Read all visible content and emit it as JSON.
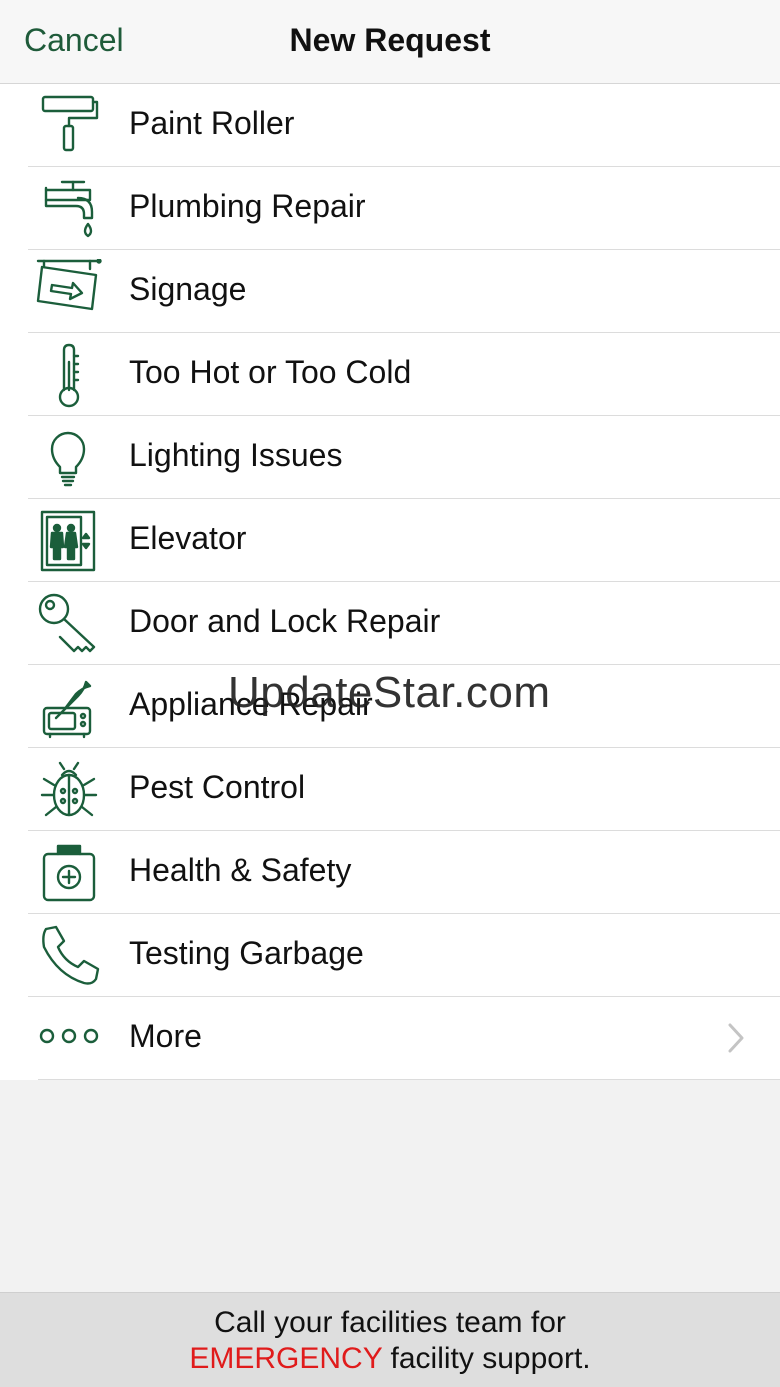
{
  "navbar": {
    "cancel_label": "Cancel",
    "title": "New Request"
  },
  "colors": {
    "accent": "#1f5b3a",
    "icon": "#1b5e3b",
    "emergency": "#e01b1b"
  },
  "items": [
    {
      "label": "Paint Roller",
      "icon": "paint-roller-icon"
    },
    {
      "label": "Plumbing Repair",
      "icon": "faucet-icon"
    },
    {
      "label": "Signage",
      "icon": "sign-icon"
    },
    {
      "label": "Too Hot or Too Cold",
      "icon": "thermometer-icon"
    },
    {
      "label": "Lighting Issues",
      "icon": "lightbulb-icon"
    },
    {
      "label": "Elevator",
      "icon": "elevator-icon"
    },
    {
      "label": "Door and Lock Repair",
      "icon": "key-icon"
    },
    {
      "label": "Appliance Repair",
      "icon": "appliance-icon"
    },
    {
      "label": "Pest Control",
      "icon": "bug-icon"
    },
    {
      "label": "Health & Safety",
      "icon": "first-aid-kit-icon"
    },
    {
      "label": "Testing Garbage",
      "icon": "phone-icon"
    },
    {
      "label": "More",
      "icon": "more-dots-icon"
    }
  ],
  "watermark": "UpdateStar.com",
  "footer": {
    "line1": "Call your facilities team for",
    "emergency": "EMERGENCY",
    "line2_rest": " facility support."
  }
}
